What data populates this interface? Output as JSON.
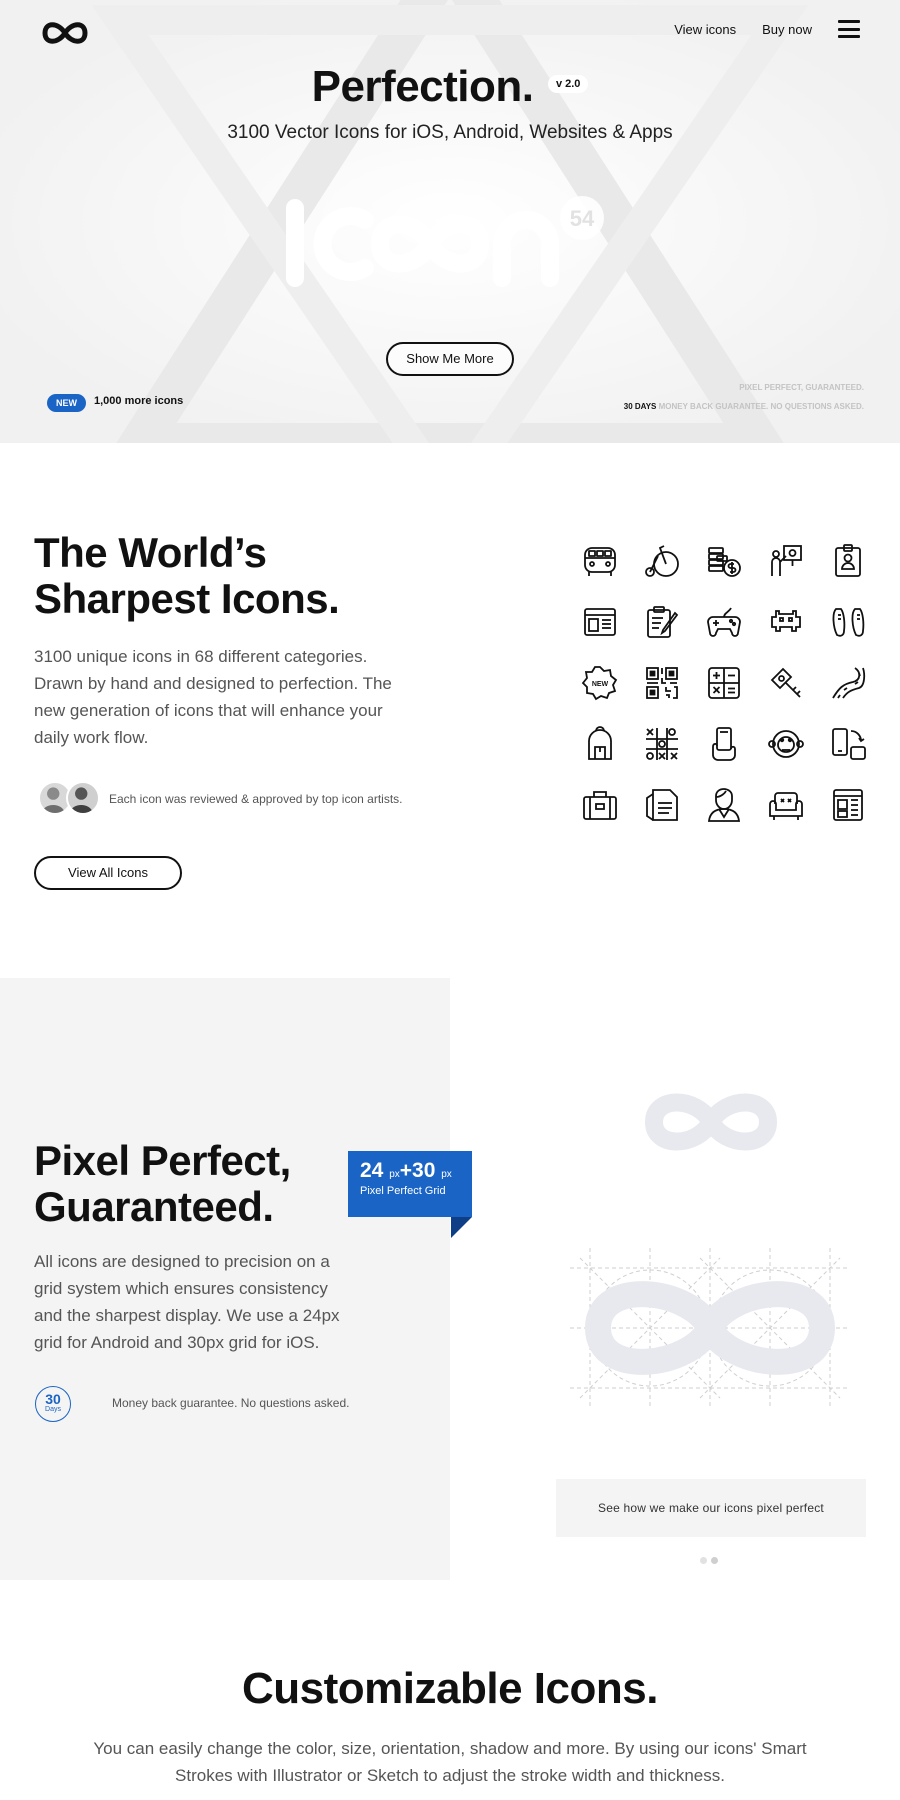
{
  "nav": {
    "logo": "infinity-logo",
    "links": [
      "View icons",
      "Buy now"
    ],
    "menu_icon": "hamburger-icon"
  },
  "hero": {
    "title": "Perfection.",
    "version": "v 2.0",
    "subtitle": "3100 Vector Icons for iOS, Android, Websites & Apps",
    "wordmark_text": "icon",
    "wordmark_sup": "54",
    "cta": "Show Me More",
    "new_badge": "NEW",
    "new_text": "1,000 more icons",
    "guarantee_line1": "PIXEL PERFECT, GUARANTEED.",
    "guarantee_days": "30 DAYS",
    "guarantee_line2": "MONEY BACK GUARANTEE. NO QUESTIONS ASKED."
  },
  "sharpest": {
    "title_line1": "The World’s",
    "title_line2": "Sharpest Icons.",
    "description": "3100 unique icons in 68 different categories. Drawn by hand and designed to perfection. The new generation of icons that will enhance your daily work flow.",
    "reviewed_text": "Each icon was reviewed & approved by top icon artists.",
    "cta": "View All Icons",
    "icons": [
      "van-icon",
      "penny-farthing-icon",
      "coins-dollar-icon",
      "presenter-icon",
      "id-badge-icon",
      "browser-layout-icon",
      "clipboard-pencil-icon",
      "gamepad-icon",
      "space-invader-icon",
      "sneakers-icon",
      "new-badge-icon",
      "qr-code-icon",
      "calculator-icon",
      "tag-key-icon",
      "road-icon",
      "backpack-icon",
      "tic-tac-toe-icon",
      "hand-phone-icon",
      "monkey-icon",
      "phone-rotate-icon",
      "suitcase-icon",
      "document-icon",
      "user-avatar-icon",
      "sofa-icon",
      "cabinet-icon"
    ],
    "new_icon_label": "NEW"
  },
  "pixel_perfect": {
    "title_line1": "Pixel Perfect,",
    "title_line2": "Guaranteed.",
    "description": "All icons are designed to precision on a grid system which ensures consistency and the sharpest display. We use a 24px grid for Android and 30px grid for iOS.",
    "days_num": "30",
    "days_label": "Days",
    "money_back": "Money back guarantee. No questions asked.",
    "tag_num1": "24",
    "tag_unit1": "px",
    "tag_plus": "+",
    "tag_num2": "30",
    "tag_unit2": "px",
    "tag_label": "Pixel Perfect Grid",
    "see_how": "See how we make our icons pixel perfect"
  },
  "customizable": {
    "title": "Customizable Icons.",
    "description": "You can easily change the color, size, orientation, shadow and more. By using our icons' Smart Strokes with Illustrator or Sketch to adjust the stroke width and thickness."
  },
  "colors": {
    "accent": "#1a64c6",
    "text": "#111111",
    "muted": "#555555",
    "panel": "#f4f4f4"
  }
}
